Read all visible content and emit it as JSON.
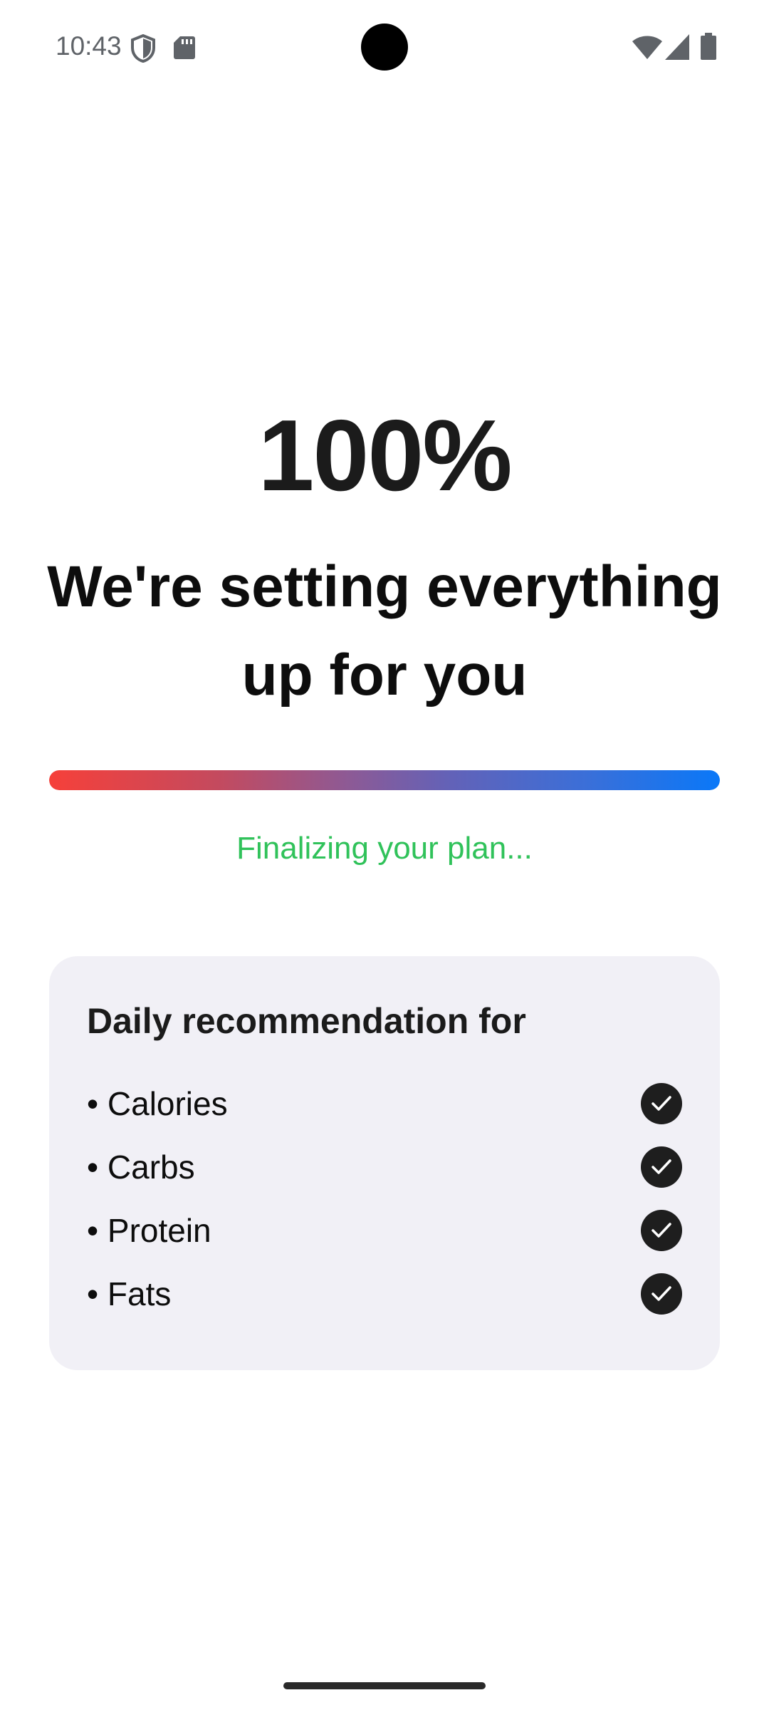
{
  "status_bar": {
    "time": "10:43",
    "icons": [
      "shield-icon",
      "sd-card-icon",
      "wifi-icon",
      "cell-signal-icon",
      "battery-icon"
    ]
  },
  "loading": {
    "percent_label": "100%",
    "headline": "We're setting everything up for you",
    "progress": 1.0,
    "status_text": "Finalizing your plan...",
    "status_color": "#30c25a",
    "progress_colors": [
      "#f6403a",
      "#0a78f8"
    ]
  },
  "recommendation_card": {
    "title": "Daily recommendation for",
    "items": [
      {
        "label": "• Calories",
        "checked": true
      },
      {
        "label": "• Carbs",
        "checked": true
      },
      {
        "label": "• Protein",
        "checked": true
      },
      {
        "label": "• Fats",
        "checked": true
      }
    ]
  }
}
